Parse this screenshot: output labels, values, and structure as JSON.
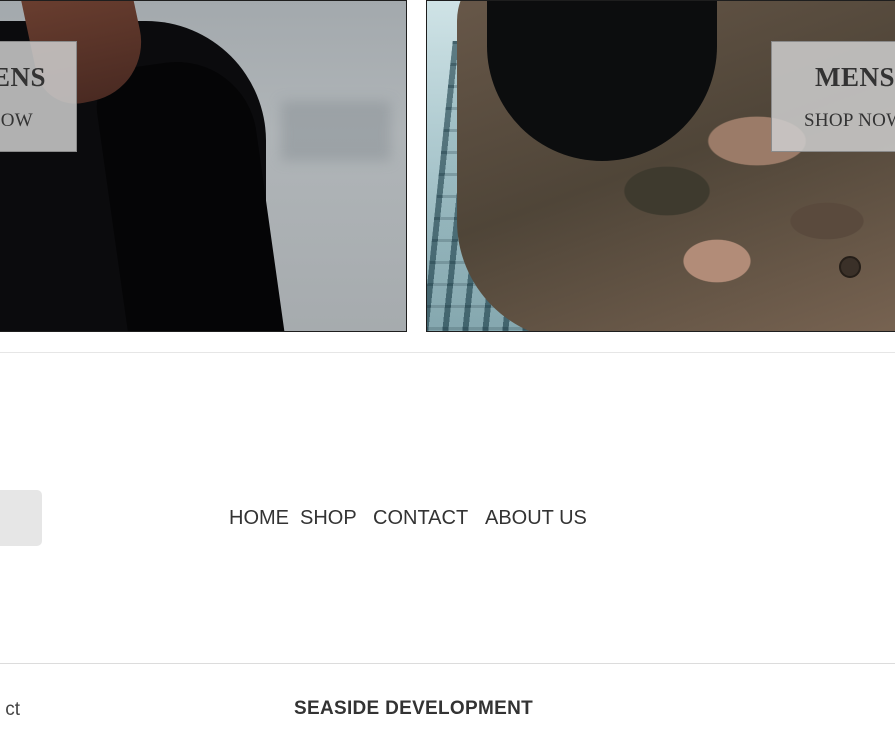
{
  "hero": {
    "left": {
      "title": "ENS",
      "link": "OW"
    },
    "right": {
      "title": "MENS",
      "link": "SHOP NOW"
    }
  },
  "nav": {
    "links": [
      "HOME",
      "SHOP",
      "CONTACT",
      "ABOUT US"
    ]
  },
  "footer": {
    "left_text": "ct",
    "brand": "SEASIDE DEVELOPMENT"
  }
}
